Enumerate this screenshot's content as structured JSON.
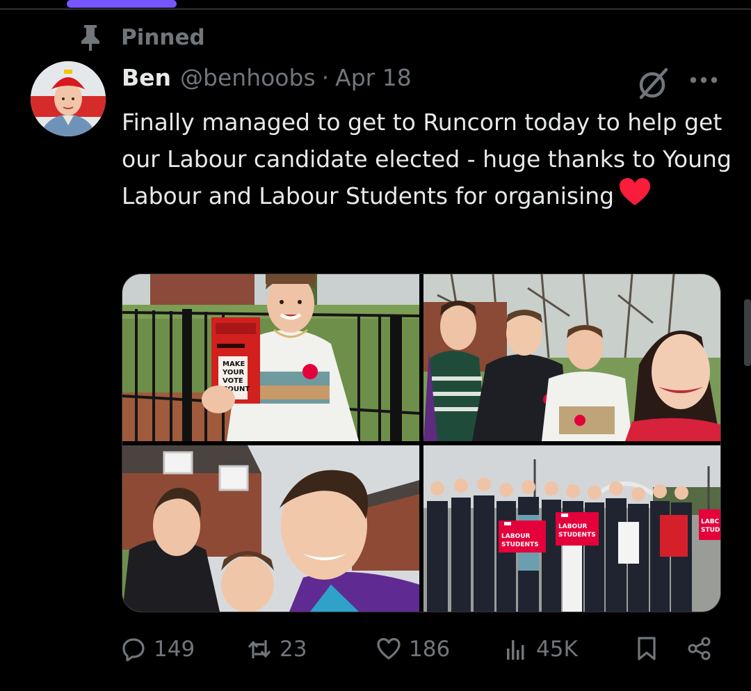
{
  "pinned": {
    "label": "Pinned"
  },
  "author": {
    "name": "Ben",
    "handle": "@benhoobs",
    "separator": "·",
    "date": "Apr 18"
  },
  "tweet": {
    "text": "Finally managed to get to Runcorn today to help get our Labour candidate elected - huge thanks to Young Labour and Labour Students for organising",
    "emoji": "red-heart"
  },
  "media": {
    "photo_1": {
      "postbox_text": [
        "MAKE",
        "YOUR",
        "VOTE",
        "COUNT"
      ]
    },
    "photo_4": {
      "placard_text": "LABOUR STUDENTS"
    }
  },
  "actions": {
    "replies": "149",
    "reposts": "23",
    "likes": "186",
    "views": "45K"
  },
  "colors": {
    "background": "#000000",
    "text": "#e7e9ea",
    "muted": "#71767b",
    "accent": "#7856ff",
    "heart": "#f91c3b",
    "labour_red": "#e4003b"
  },
  "icons": [
    "pin-icon",
    "grok-icon",
    "more-icon",
    "reply-icon",
    "repost-icon",
    "like-icon",
    "views-icon",
    "bookmark-icon",
    "share-icon"
  ]
}
